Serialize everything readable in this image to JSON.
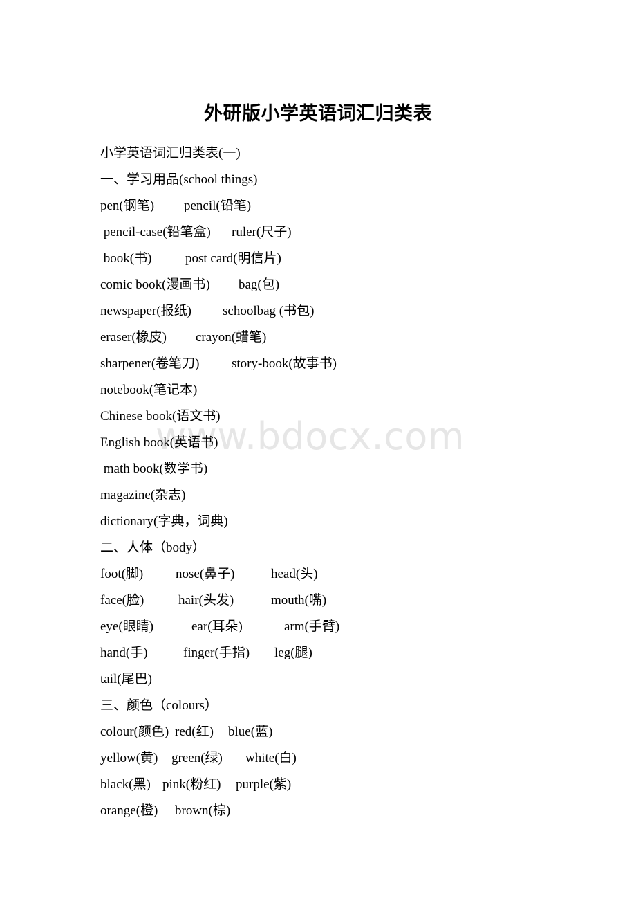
{
  "document": {
    "title": "外研版小学英语词汇归类表",
    "subtitle": "小学英语词汇归类表(一)",
    "watermark": "www.bdocx.com",
    "watermark_color": "#e6e6e6",
    "text_color": "#000000",
    "background_color": "#ffffff"
  },
  "sections": [
    {
      "heading": "一、学习用品(school things)",
      "rows": [
        {
          "cells": [
            "pen(钢笔)",
            "pencil(铅笔)"
          ],
          "x": [
            145,
            266
          ]
        },
        {
          "cells": [
            " pencil-case(铅笔盒)",
            "ruler(尺子)"
          ],
          "x": [
            145,
            335
          ]
        },
        {
          "cells": [
            " book(书)",
            "post card(明信片)"
          ],
          "x": [
            145,
            268
          ]
        },
        {
          "cells": [
            "comic book(漫画书)",
            "bag(包)"
          ],
          "x": [
            145,
            345
          ]
        },
        {
          "cells": [
            "newspaper(报纸)",
            "schoolbag (书包)"
          ],
          "x": [
            145,
            322
          ]
        },
        {
          "cells": [
            "eraser(橡皮)",
            "crayon(蜡笔)"
          ],
          "x": [
            145,
            283
          ]
        },
        {
          "cells": [
            "sharpener(卷笔刀)",
            "story-book(故事书)"
          ],
          "x": [
            145,
            335
          ]
        },
        {
          "cells": [
            "notebook(笔记本)"
          ],
          "x": [
            145
          ]
        },
        {
          "cells": [
            "Chinese book(语文书)"
          ],
          "x": [
            145
          ]
        },
        {
          "cells": [
            "English book(英语书)"
          ],
          "x": [
            145
          ]
        },
        {
          "cells": [
            " math book(数学书)"
          ],
          "x": [
            145
          ]
        },
        {
          "cells": [
            "magazine(杂志)"
          ],
          "x": [
            145
          ]
        },
        {
          "cells": [
            "dictionary(字典，词典)"
          ],
          "x": [
            145
          ]
        }
      ]
    },
    {
      "heading": "二、人体（body）",
      "rows": [
        {
          "cells": [
            "foot(脚)",
            "nose(鼻子)",
            "head(头)"
          ],
          "x": [
            145,
            254,
            392
          ]
        },
        {
          "cells": [
            "face(脸)",
            "hair(头发)",
            "mouth(嘴)"
          ],
          "x": [
            145,
            258,
            392
          ]
        },
        {
          "cells": [
            "eye(眼睛)",
            "ear(耳朵)",
            "arm(手臂)"
          ],
          "x": [
            145,
            277,
            411
          ]
        },
        {
          "cells": [
            "hand(手)",
            "finger(手指)",
            "leg(腿)"
          ],
          "x": [
            145,
            265,
            397
          ]
        },
        {
          "cells": [
            "tail(尾巴)"
          ],
          "x": [
            145
          ]
        }
      ]
    },
    {
      "heading": "三、颜色（colours）",
      "rows": [
        {
          "cells": [
            "colour(颜色)",
            "red(红)",
            "blue(蓝)"
          ],
          "x": [
            145,
            253,
            330
          ]
        },
        {
          "cells": [
            "yellow(黄)",
            "green(绿)",
            "white(白)"
          ],
          "x": [
            145,
            248,
            355
          ]
        },
        {
          "cells": [
            "black(黑)",
            "pink(粉红)",
            "purple(紫)"
          ],
          "x": [
            145,
            235,
            341
          ]
        },
        {
          "cells": [
            "orange(橙)",
            "brown(棕)"
          ],
          "x": [
            145,
            253
          ]
        }
      ]
    }
  ]
}
